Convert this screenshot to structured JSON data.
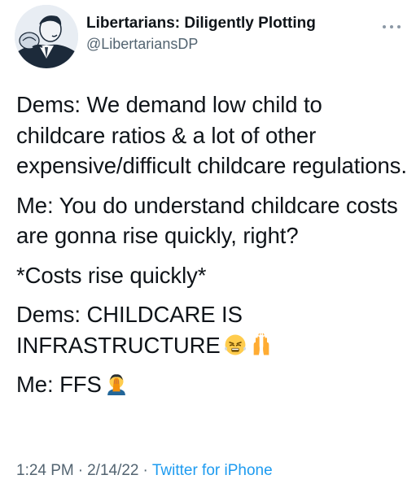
{
  "author": {
    "display_name": "Libertarians: Diligently Plotting",
    "handle": "@LibertariansDP",
    "avatar_icon": "illustrated-man-avatar-icon"
  },
  "more_icon": "more-options-icon",
  "tweet": {
    "paragraphs": [
      {
        "text": "Dems: We demand low child to childcare ratios & a lot of other expensive/difficult childcare regulations."
      },
      {
        "text": "Me: You do understand childcare costs are gonna rise quickly, right?"
      },
      {
        "text": "*Costs rise quickly*"
      },
      {
        "text": "Dems: CHILDCARE IS INFRASTRUCTURE",
        "emojis": [
          "face-with-steam-emoji",
          "raising-hands-emoji"
        ]
      },
      {
        "text": "Me: FFS",
        "emojis": [
          "facepalm-emoji"
        ]
      }
    ]
  },
  "meta": {
    "time": "1:24 PM",
    "separator": "·",
    "date": "2/14/22",
    "source": "Twitter for iPhone"
  },
  "colors": {
    "text": "#0f1419",
    "secondary": "#536471",
    "link": "#1d9bf0"
  }
}
